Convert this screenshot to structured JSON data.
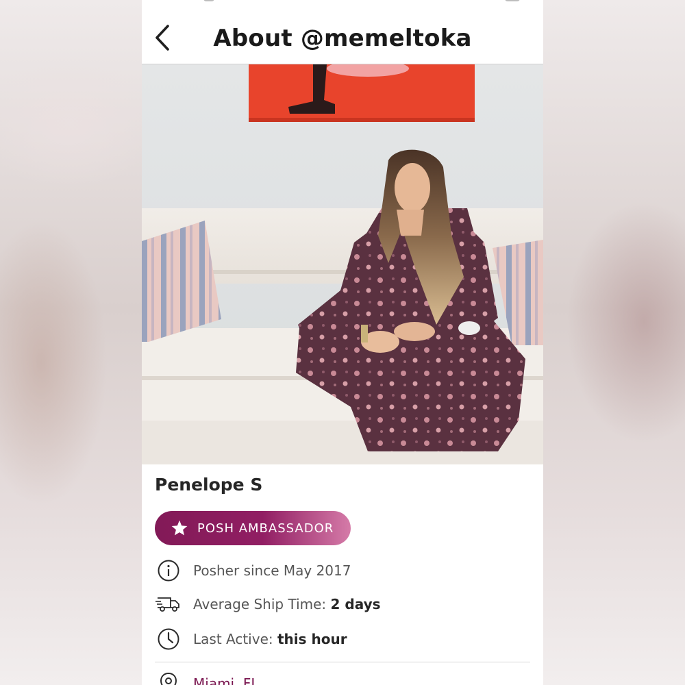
{
  "header": {
    "title": "About @memeltoka",
    "back_icon": "chevron-left-icon"
  },
  "hero": {
    "icon": "profile-cover-photo"
  },
  "profile": {
    "display_name": "Penelope S",
    "badge": {
      "label": "POSH AMBASSADOR",
      "icon": "star-icon",
      "gradient_from": "#821a57",
      "gradient_to": "#d57ba8"
    },
    "info": [
      {
        "icon": "info-circle-icon",
        "label": "Posher since May 2017",
        "value": ""
      },
      {
        "icon": "delivery-truck-icon",
        "label": "Average Ship Time: ",
        "value": "2 days"
      },
      {
        "icon": "clock-icon",
        "label": "Last Active: ",
        "value": "this hour"
      }
    ],
    "location": {
      "icon": "location-pin-icon",
      "label": "Miami, FL"
    }
  },
  "colors": {
    "accent": "#7a1650",
    "text_primary": "#262626",
    "text_secondary": "#565656"
  }
}
